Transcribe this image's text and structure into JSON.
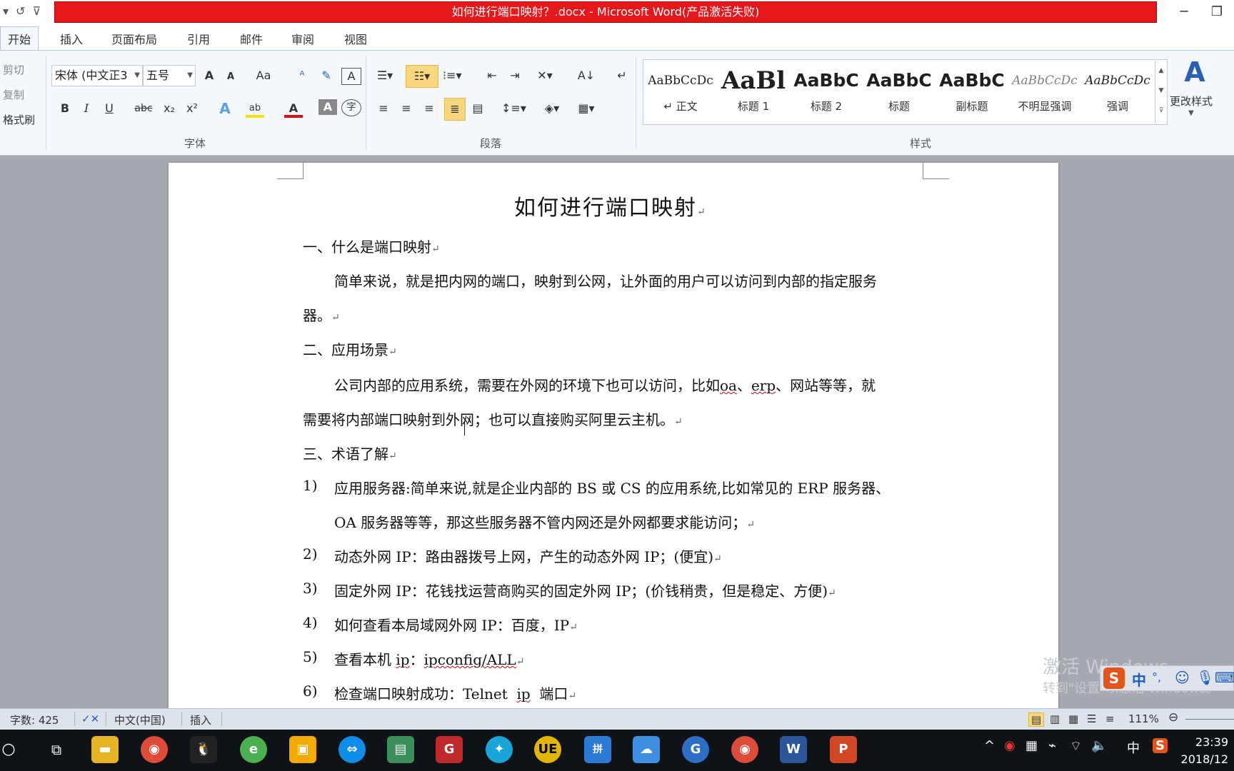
{
  "titlebar": {
    "title": "如何进行端口映射？.docx - Microsoft Word(产品激活失败)",
    "qat_icons": [
      "dropdown-icon",
      "undo-icon",
      "customize-icon"
    ],
    "minimize": "─",
    "restore": "❐"
  },
  "tabs": [
    "开始",
    "插入",
    "页面布局",
    "引用",
    "邮件",
    "审阅",
    "视图"
  ],
  "ribbon": {
    "clipboard": {
      "cut": "剪切",
      "copy": "复制",
      "format_painter": "格式刷"
    },
    "font": {
      "font_name": "宋体 (中文正3",
      "font_size": "五号",
      "grow": "A",
      "shrink": "A",
      "change_case": "Aa",
      "group_label": "字体",
      "bold": "B",
      "italic": "I",
      "underline": "U",
      "strike": "abc",
      "subscript": "x₂",
      "superscript": "x²",
      "highlight": "ab",
      "font_color": "A",
      "char_shading": "A",
      "enclose": "字"
    },
    "paragraph": {
      "group_label": "段落"
    },
    "styles": {
      "group_label": "样式",
      "items": [
        {
          "preview": "AaBbCcDc",
          "name": "↵ 正文"
        },
        {
          "preview": "AaBl",
          "name": "标题 1"
        },
        {
          "preview": "AaBbC",
          "name": "标题 2"
        },
        {
          "preview": "AaBbC",
          "name": "标题"
        },
        {
          "preview": "AaBbC",
          "name": "副标题"
        },
        {
          "preview": "AaBbCcDc",
          "name": "不明显强调"
        },
        {
          "preview": "AaBbCcDc",
          "name": "强调"
        }
      ],
      "change_styles": "更改样式"
    }
  },
  "document": {
    "title": "如何进行端口映射",
    "lines": [
      "一、什么是端口映射",
      "简单来说，就是把内网的端口，映射到公网，让外面的用户可以访问到内部的指定服务",
      "器。",
      "二、应用场景",
      "公司内部的应用系统，需要在外网的环境下也可以访问，比如",
      "oa",
      "、",
      "erp",
      "、网站等等，就",
      "需要将内部端口映射到外网；也可以直接购买阿里云主机。",
      "三、术语了解"
    ],
    "list": [
      {
        "num": "1)",
        "text": "应用服务器:简单来说,就是企业内部的 BS 或 CS 的应用系统,比如常见的 ERP 服务器、",
        "cont": "OA 服务器等等，那这些服务器不管内网还是外网都要求能访问；"
      },
      {
        "num": "2)",
        "text": "动态外网 IP：路由器拨号上网，产生的动态外网 IP；(便宜)"
      },
      {
        "num": "3)",
        "text": "固定外网 IP：花钱找运营商购买的固定外网 IP；(价钱稍贵，但是稳定、方便)"
      },
      {
        "num": "4)",
        "text": "如何查看本局域网外网 IP：百度，IP"
      },
      {
        "num": "5)",
        "pre": "查看本机 ",
        "ip": "ip",
        "mid": "：",
        "cmd": "ipconfig/ALL"
      },
      {
        "num": "6)",
        "pre": "检查端口映射成功：Telnet  ",
        "ip": "ip",
        "post": "  端口"
      }
    ],
    "para_mark": "↵"
  },
  "watermark": {
    "line1": "激活 Windows",
    "line2": "转到\"设置\"以激活 Windows。"
  },
  "ime": {
    "logo": "S",
    "mode": "中",
    "punct": "°,"
  },
  "statusbar": {
    "word_count": "字数: 425",
    "language": "中文(中国)",
    "insert_mode": "插入",
    "zoom": "111%"
  },
  "taskbar": {
    "apps": [
      "start-button",
      "task-view",
      "file-explorer",
      "chrome",
      "qq",
      "green-app",
      "folder-app",
      "teamviewer",
      "network-app",
      "red-app",
      "edge-app",
      "ue",
      "ime-app",
      "cloud-app",
      "blue-app",
      "chrome2",
      "word",
      "powerpoint"
    ],
    "tray_lang": "中",
    "time": "23:39",
    "date": "2018/12"
  },
  "colors": {
    "title_red": "#e5171b",
    "ribbon_bg": "#f5f8fc",
    "page_bg": "#ffffff",
    "workspace": "#a6aab0",
    "taskbar": "#0f1216"
  }
}
